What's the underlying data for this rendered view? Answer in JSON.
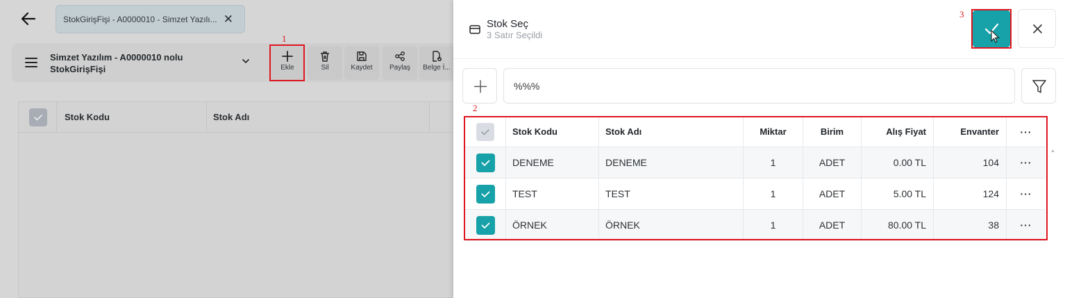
{
  "background": {
    "tab_title": "StokGirişFişi - A0000010 - Simzet Yazılı...",
    "doc_title_line1": "Simzet Yazılım - A0000010 nolu",
    "doc_title_line2": "StokGirişFişi",
    "toolbar": {
      "add_label": "Ekle",
      "delete_label": "Sil",
      "save_label": "Kaydet",
      "share_label": "Paylaş",
      "doc_label": "Belge İ..."
    },
    "table_headers": [
      "Stok Kodu",
      "Stok Adı"
    ]
  },
  "panel": {
    "title": "Stok Seç",
    "subtitle": "3 Satır Seçildi",
    "search_value": "%%%",
    "columns": {
      "code": "Stok Kodu",
      "name": "Stok Adı",
      "qty": "Miktar",
      "unit": "Birim",
      "price": "Alış Fiyat",
      "inventory": "Envanter",
      "more": "···"
    },
    "rows": [
      {
        "code": "DENEME",
        "name": "DENEME",
        "qty": "1",
        "unit": "ADET",
        "price": "0.00 TL",
        "inventory": "104",
        "more": "···",
        "checked": true
      },
      {
        "code": "TEST",
        "name": "TEST",
        "qty": "1",
        "unit": "ADET",
        "price": "5.00 TL",
        "inventory": "124",
        "more": "···",
        "checked": true
      },
      {
        "code": "ÖRNEK",
        "name": "ÖRNEK",
        "qty": "1",
        "unit": "ADET",
        "price": "80.00 TL",
        "inventory": "38",
        "more": "···",
        "checked": true
      }
    ]
  },
  "annotations": {
    "step1": "1",
    "step2": "2",
    "step3": "3"
  },
  "colors": {
    "accent": "#17a1a8",
    "highlight": "#e0141e"
  },
  "icons": [
    "back-arrow-icon",
    "close-icon",
    "hamburger-icon",
    "chevron-down-icon",
    "plus-icon",
    "trash-icon",
    "save-icon",
    "share-icon",
    "document-check-icon",
    "box-icon",
    "check-icon",
    "filter-icon"
  ]
}
